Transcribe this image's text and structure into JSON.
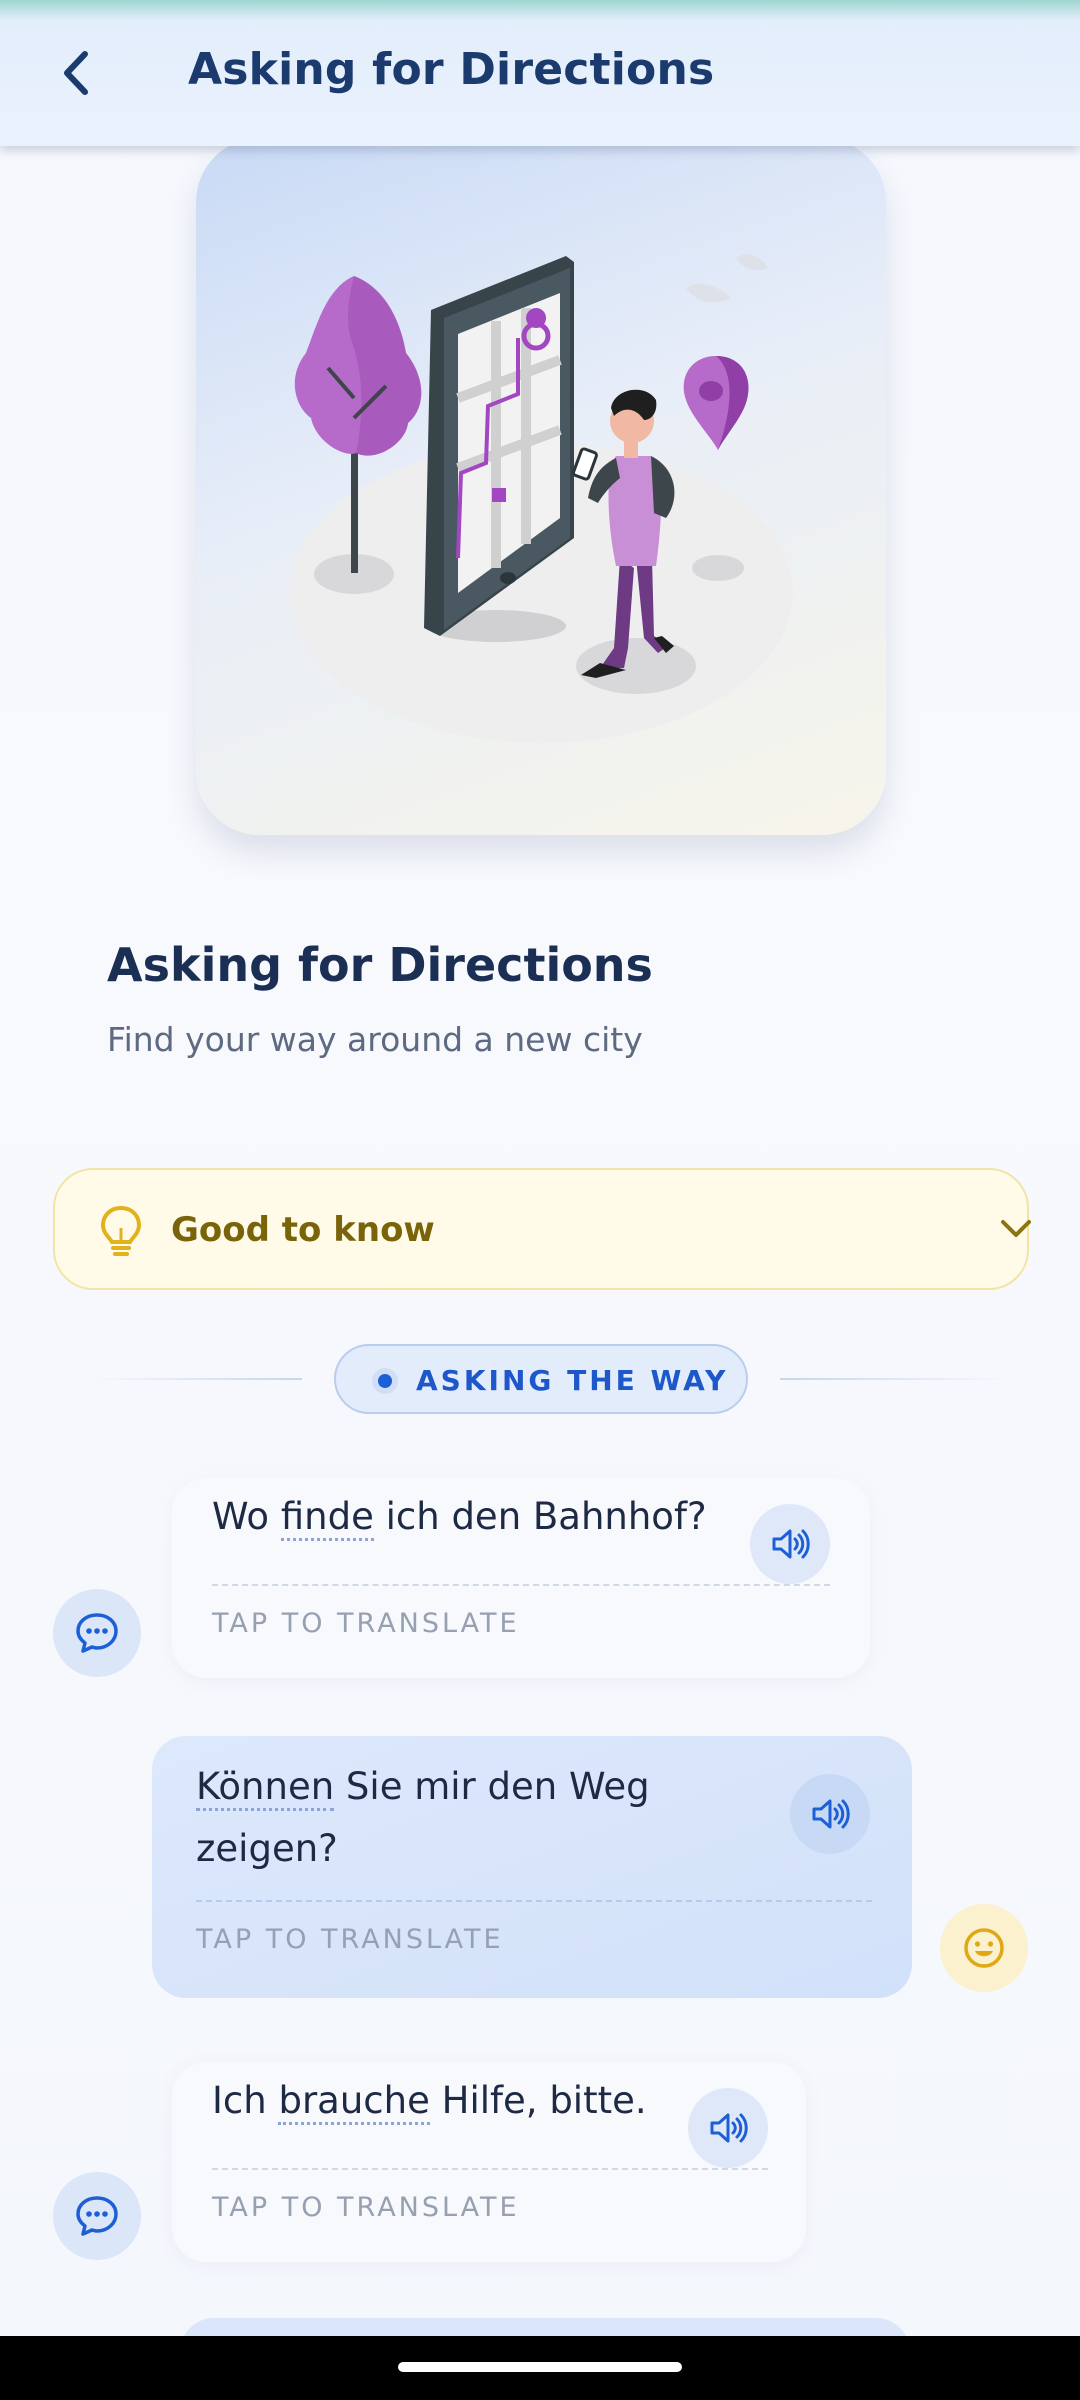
{
  "header": {
    "title": "Asking for Directions",
    "back_icon": "chevron-left-icon"
  },
  "hero": {
    "illustration": "map-phone-illustration"
  },
  "lesson": {
    "title": "Asking for Directions",
    "subtitle": "Find your way around a new city"
  },
  "tip": {
    "label": "Good to know",
    "icon": "lightbulb-icon",
    "expanded": false
  },
  "section": {
    "label": "ASKING THE WAY"
  },
  "phrases": [
    {
      "speaker": "other",
      "text_before": "Wo ",
      "highlight": "finde",
      "text_after": " ich den Bahnhof?",
      "hint": "TAP TO TRANSLATE"
    },
    {
      "speaker": "user",
      "text_before": "",
      "highlight": "Können",
      "text_after": " Sie mir den Weg zeigen?",
      "hint": "TAP TO TRANSLATE"
    },
    {
      "speaker": "other",
      "text_before": "Ich ",
      "highlight": "brauche",
      "text_after": " Hilfe, bitte.",
      "hint": "TAP TO TRANSLATE"
    }
  ],
  "colors": {
    "accent": "#1d5fd6",
    "title": "#1b2f55",
    "tip_bg": "#fffbe8",
    "tip_text": "#7a6409",
    "user_bubble": "#d6e3fa"
  }
}
